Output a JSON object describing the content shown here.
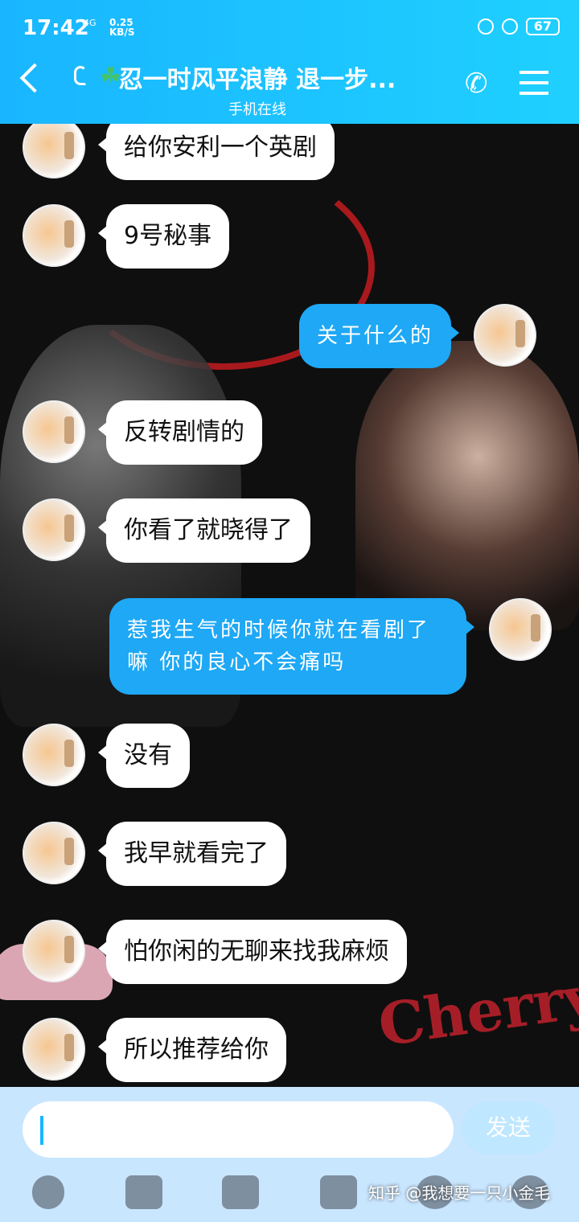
{
  "status": {
    "time": "17:42",
    "network": "4G",
    "speed_value": "0.25",
    "speed_unit": "KB/S",
    "battery": "67"
  },
  "header": {
    "title": "忍一时风平浪静 退一步...",
    "subtitle": "手机在线"
  },
  "messages": [
    {
      "side": "left",
      "text": "给你安利一个英剧"
    },
    {
      "side": "left",
      "text": "9号秘事"
    },
    {
      "side": "right",
      "text": "关于什么的"
    },
    {
      "side": "left",
      "text": "反转剧情的"
    },
    {
      "side": "left",
      "text": "你看了就晓得了"
    },
    {
      "side": "right",
      "text": "惹我生气的时候你就在看剧了嘛 你的良心不会痛吗"
    },
    {
      "side": "left",
      "text": "没有"
    },
    {
      "side": "left",
      "text": "我早就看完了"
    },
    {
      "side": "left",
      "text": "怕你闲的无聊来找我麻烦"
    },
    {
      "side": "left",
      "text": "所以推荐给你"
    }
  ],
  "background": {
    "cherry_text": "Cherry"
  },
  "input": {
    "value": "",
    "send_label": "发送"
  },
  "watermark": "知乎 @我想要一只小金毛"
}
